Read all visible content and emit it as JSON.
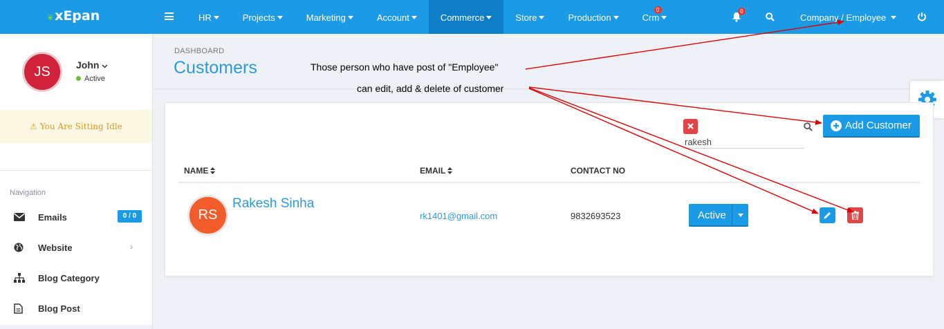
{
  "brand": "xEpan",
  "topnav": {
    "items": [
      "HR",
      "Projects",
      "Marketing",
      "Account",
      "Commerce",
      "Store",
      "Production",
      "Crm"
    ],
    "active": "Commerce",
    "crm_badge": "0",
    "bell_badge": "0",
    "company_label": "Company / Employee"
  },
  "user": {
    "initials": "JS",
    "name": "John",
    "status": "Active"
  },
  "idle_message": "You Are Sitting Idle",
  "navigation": {
    "title": "Navigation",
    "items": [
      {
        "label": "Emails",
        "badge": "0 / 0",
        "icon": "envelope-icon"
      },
      {
        "label": "Website",
        "icon": "globe-icon"
      },
      {
        "label": "Blog Category",
        "icon": "sitemap-icon"
      },
      {
        "label": "Blog Post",
        "icon": "document-icon"
      }
    ]
  },
  "page": {
    "breadcrumb": "DASHBOARD",
    "title": "Customers"
  },
  "annotations": {
    "line1": "Those person who have post of \"Employee\"",
    "line2": "can edit, add & delete of customer"
  },
  "search": {
    "value": "rakesh"
  },
  "add_button_label": "Add Customer",
  "table": {
    "headers": {
      "name": "NAME",
      "email": "EMAIL",
      "contact": "CONTACT NO"
    },
    "rows": [
      {
        "initials": "RS",
        "name": "Rakesh Sinha",
        "email": "rk1401@gmail.com",
        "contact": "9832693523",
        "status": "Active"
      }
    ]
  },
  "colors": {
    "primary": "#1b9ae6",
    "danger": "#e04646",
    "annotation_arrow": "#e00000"
  }
}
